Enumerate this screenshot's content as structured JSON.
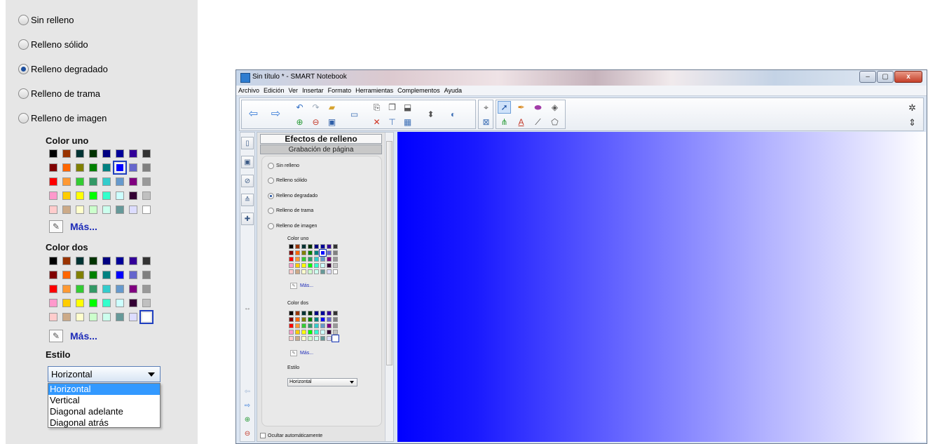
{
  "zoom_panel": {
    "fill_options": [
      {
        "label": "Sin relleno",
        "selected": false
      },
      {
        "label": "Relleno sólido",
        "selected": false
      },
      {
        "label": "Relleno degradado",
        "selected": true
      },
      {
        "label": "Relleno de trama",
        "selected": false
      },
      {
        "label": "Relleno de imagen",
        "selected": false
      }
    ],
    "color_one_label": "Color uno",
    "color_two_label": "Color dos",
    "more_label": "Más...",
    "style_label": "Estilo",
    "style_value": "Horizontal",
    "style_options": [
      "Horizontal",
      "Vertical",
      "Diagonal adelante",
      "Diagonal atrás"
    ]
  },
  "palette": [
    "#000000",
    "#993300",
    "#003333",
    "#003300",
    "#000080",
    "#000099",
    "#330099",
    "#333333",
    "#800000",
    "#ff6600",
    "#808000",
    "#008000",
    "#008080",
    "#0000ff",
    "#6666cc",
    "#808080",
    "#ff0000",
    "#ff9933",
    "#33cc33",
    "#339966",
    "#33cccc",
    "#6699cc",
    "#800080",
    "#999999",
    "#ff99cc",
    "#ffcc00",
    "#ffff00",
    "#00ff00",
    "#33ffcc",
    "#ccffff",
    "#330033",
    "#c0c0c0",
    "#ffcccc",
    "#ccaa88",
    "#ffffcc",
    "#ccffcc",
    "#ccffee",
    "#669999",
    "#ddddff",
    "#ffffff"
  ],
  "selected_color_one": 13,
  "selected_color_two": 39,
  "window": {
    "title": "Sin título * - SMART Notebook",
    "buttons": {
      "minimize": "–",
      "maximize": "▢",
      "close": "x"
    },
    "menu": [
      "Archivo",
      "Edición",
      "Ver",
      "Insertar",
      "Formato",
      "Herramientas",
      "Complementos",
      "Ayuda"
    ],
    "panel_title": "Efectos de relleno",
    "panel_subtitle": "Grabación de página",
    "fill_options": [
      "Sin relleno",
      "Relleno sólido",
      "Relleno degradado",
      "Relleno de trama",
      "Relleno de imagen"
    ],
    "selected_fill": 2,
    "color_one_label": "Color uno",
    "color_two_label": "Color dos",
    "more_label": "Más...",
    "style_label": "Estilo",
    "style_value": "Horizontal",
    "autohide_label": "Ocultar automáticamente",
    "toolbar_icons": [
      "back-arrow-icon",
      "forward-arrow-icon",
      "undo-icon",
      "redo-icon",
      "open-folder-icon",
      "add-page-icon",
      "delete-page-icon",
      "save-icon",
      "screen-icon",
      "paste-icon",
      "delete-icon",
      "screen-shade-icon",
      "clone-icon",
      "table-icon",
      "insert-icon",
      "magic-icon",
      "select-arrow-icon",
      "pen-icon",
      "eraser-icon",
      "fill-icon",
      "creative-pen-icon",
      "text-icon",
      "line-icon",
      "shape-icon",
      "settings-gear-icon",
      "move-toolbar-icon"
    ],
    "side_tabs": [
      "page-sorter-icon",
      "gallery-icon",
      "attachments-icon",
      "properties-icon",
      "addons-icon"
    ]
  },
  "canvas_gradient": {
    "from": "#0000ff",
    "to": "#ffffff",
    "direction": "horizontal"
  }
}
